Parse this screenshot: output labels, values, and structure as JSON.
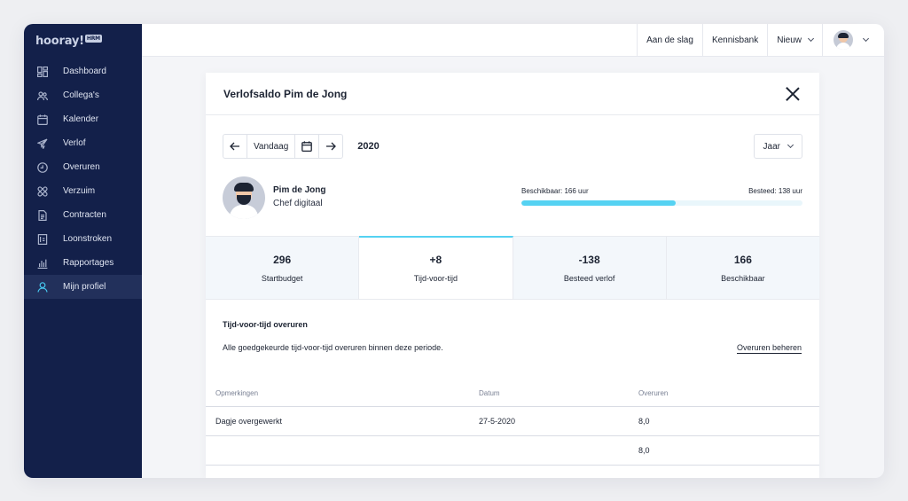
{
  "logo": {
    "name": "hooray!",
    "badge": "HRM"
  },
  "sidebar": {
    "items": [
      {
        "label": "Dashboard",
        "icon": "dashboard-icon"
      },
      {
        "label": "Collega's",
        "icon": "people-icon"
      },
      {
        "label": "Kalender",
        "icon": "calendar-icon"
      },
      {
        "label": "Verlof",
        "icon": "plane-icon"
      },
      {
        "label": "Overuren",
        "icon": "clock-icon"
      },
      {
        "label": "Verzuim",
        "icon": "bandage-icon"
      },
      {
        "label": "Contracten",
        "icon": "document-icon"
      },
      {
        "label": "Loonstroken",
        "icon": "payslip-icon"
      },
      {
        "label": "Rapportages",
        "icon": "bar-chart-icon"
      },
      {
        "label": "Mijn profiel",
        "icon": "user-icon"
      }
    ],
    "active_index": 9
  },
  "topbar": {
    "get_started": "Aan de slag",
    "knowledge_base": "Kennisbank",
    "new": "Nieuw"
  },
  "modal": {
    "title": "Verlofsaldo Pim de Jong",
    "today": "Vandaag",
    "year": "2020",
    "period": "Jaar",
    "person": {
      "name": "Pim de Jong",
      "role": "Chef digitaal"
    },
    "progress": {
      "available_label": "Beschikbaar: 166 uur",
      "spent_label": "Besteed: 138 uur",
      "fill_percent": 55
    },
    "stats": [
      {
        "value": "296",
        "label": "Startbudget"
      },
      {
        "value": "+8",
        "label": "Tijd-voor-tijd"
      },
      {
        "value": "-138",
        "label": "Besteed verlof"
      },
      {
        "value": "166",
        "label": "Beschikbaar"
      }
    ],
    "active_stat": 1,
    "section": {
      "title": "Tijd-voor-tijd overuren",
      "description": "Alle goedgekeurde tijd-voor-tijd overuren binnen deze periode.",
      "manage_link": "Overuren beheren"
    },
    "table": {
      "headers": [
        "Opmerkingen",
        "Datum",
        "Overuren"
      ],
      "rows": [
        [
          "Dagje overgewerkt",
          "27-5-2020",
          "8,0"
        ]
      ],
      "total": [
        "",
        "",
        "8,0"
      ]
    }
  },
  "colors": {
    "sidebar_bg": "#13204a",
    "accent": "#55d2f2",
    "active_item_bg": "#22305b"
  }
}
